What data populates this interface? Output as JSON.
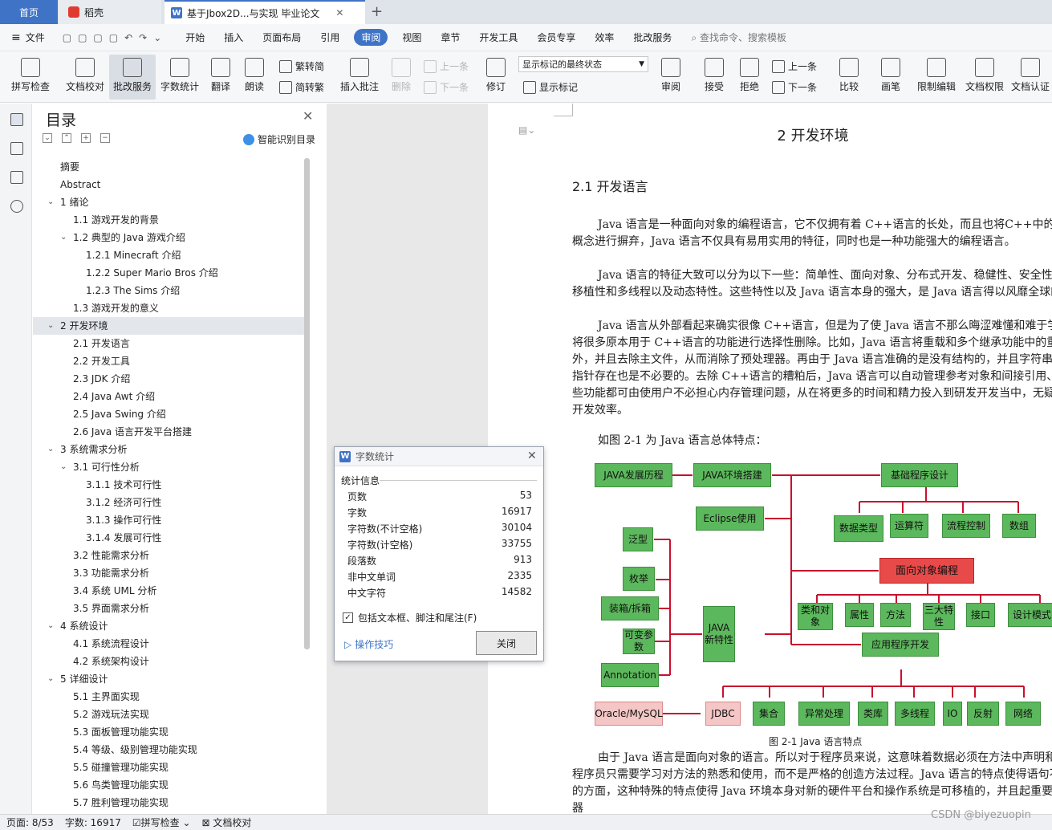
{
  "tabs": {
    "home": "首页",
    "docer": "稻壳",
    "doc": "基于Jbox2D...与实现 毕业论文",
    "add": "+"
  },
  "menu": {
    "file": "文件",
    "items": [
      "开始",
      "插入",
      "页面布局",
      "引用",
      "审阅",
      "视图",
      "章节",
      "开发工具",
      "会员专享",
      "效率",
      "批改服务"
    ],
    "active": "审阅",
    "search": "查找命令、搜索模板"
  },
  "ribbon": {
    "spell": "拼写检查",
    "proof": "文档校对",
    "correct": "批改服务",
    "count": "字数统计",
    "translate": "翻译",
    "read": "朗读",
    "fan2jian": "繁转简",
    "jian2fan": "简转繁",
    "add_comment": "插入批注",
    "delete": "删除",
    "prev": "上一条",
    "next": "下一条",
    "revise": "修订",
    "show_select": "显示标记的最终状态",
    "show_marks": "显示标记",
    "review": "审阅",
    "accept": "接受",
    "reject": "拒绝",
    "prev2": "上一条",
    "next2": "下一条",
    "compare": "比较",
    "pen": "画笔",
    "restrict": "限制编辑",
    "perm": "文档权限",
    "auth": "文档认证"
  },
  "toc": {
    "title": "目录",
    "smart": "智能识别目录",
    "items": [
      {
        "t": "摘要",
        "lv": 0
      },
      {
        "t": "Abstract",
        "lv": 0
      },
      {
        "t": "1  绪论",
        "lv": 1,
        "c": "v"
      },
      {
        "t": "1.1  游戏开发的背景",
        "lv": 2
      },
      {
        "t": "1.2  典型的 Java 游戏介绍",
        "lv": 2,
        "c": "v"
      },
      {
        "t": "1.2.1 Minecraft 介绍",
        "lv": 3
      },
      {
        "t": "1.2.2 Super Mario Bros 介绍",
        "lv": 3
      },
      {
        "t": "1.2.3 The Sims 介绍",
        "lv": 3
      },
      {
        "t": "1.3  游戏开发的意义",
        "lv": 2
      },
      {
        "t": "2  开发环境",
        "lv": 1,
        "c": "v",
        "sel": true
      },
      {
        "t": "2.1  开发语言",
        "lv": 2
      },
      {
        "t": "2.2  开发工具",
        "lv": 2
      },
      {
        "t": "2.3 JDK 介绍",
        "lv": 2
      },
      {
        "t": "2.4 Java Awt 介绍",
        "lv": 2
      },
      {
        "t": "2.5 Java Swing  介绍",
        "lv": 2
      },
      {
        "t": "2.6 Java 语言开发平台搭建",
        "lv": 2
      },
      {
        "t": "3 系统需求分析",
        "lv": 1,
        "c": "v"
      },
      {
        "t": "3.1  可行性分析",
        "lv": 2,
        "c": "v"
      },
      {
        "t": "3.1.1  技术可行性",
        "lv": 3
      },
      {
        "t": "3.1.2  经济可行性",
        "lv": 3
      },
      {
        "t": "3.1.3  操作可行性",
        "lv": 3
      },
      {
        "t": "3.1.4  发展可行性",
        "lv": 3
      },
      {
        "t": "3.2  性能需求分析",
        "lv": 2
      },
      {
        "t": "3.3  功能需求分析",
        "lv": 2
      },
      {
        "t": "3.4  系统 UML 分析",
        "lv": 2
      },
      {
        "t": "3.5 界面需求分析",
        "lv": 2
      },
      {
        "t": "4  系统设计",
        "lv": 1,
        "c": "v"
      },
      {
        "t": "4.1 系统流程设计",
        "lv": 2
      },
      {
        "t": "4.2  系统架构设计",
        "lv": 2
      },
      {
        "t": "5  详细设计",
        "lv": 1,
        "c": "v"
      },
      {
        "t": "5.1  主界面实现",
        "lv": 2
      },
      {
        "t": "5.2  游戏玩法实现",
        "lv": 2
      },
      {
        "t": "5.3  面板管理功能实现",
        "lv": 2
      },
      {
        "t": "5.4  等级、级别管理功能实现",
        "lv": 2
      },
      {
        "t": "5.5  碰撞管理功能实现",
        "lv": 2
      },
      {
        "t": "5.6  鸟类管理功能实现",
        "lv": 2
      },
      {
        "t": "5.7  胜利管理功能实现",
        "lv": 2
      }
    ]
  },
  "doc": {
    "h1": "2  开发环境",
    "h2": "2.1  开发语言",
    "p1": "Java 语言是一种面向对象的编程语言，它不仅拥有着 C++语言的长处，而且也将C++中的多重继承和指针等概念进行摒弃，Java 语言不仅具有易用实用的特征，同时也是一种功能强大的编程语言。",
    "p2": "Java 语言的特征大致可以分为以下一些：简单性、面向对象、分布式开发、稳健性、安全性、平台独立性、可移植性和多线程以及动态特性。这些特性以及 Java 语言本身的强大，是 Java 语言得以风靡全球的根本原因。",
    "p3": "Java 语言从外部看起来确实很像 C++语言，但是为了使 Java 语言不那么晦涩难懂和难于学习，开发设计人员将很多原本用于 C++语言的功能进行选择性删除。比如，Java 语言将重载和多个继承功能中的重载运算符排除在外，并且去除主文件，从而消除了预处理器。再由于 Java 语言准确的是没有结构的，并且字符串数组是对象，所以指针存在也是不必要的。去除 C++语言的糟粕后，Java 语言可以自动管理参考对象和间接引用、自动垃圾收集，这些功能都可由使用户不必担心内存管理问题，从在将更多的时间和精力投入到研发开发当中，无疑是大大提升了编程开发效率。",
    "p4": "如图 2-1 为 Java 语言总体特点：",
    "caption": "图 2-1  Java 语言特点",
    "p5": "由于 Java 语言是面向对象的语言。所以对于程序员来说，这意味着数据必须在方法中声明和操纵，笼统来说，程序员只需要学习对方法的熟悉和使用，而不是严格的创造方法过程。Java 语言的特点使得语句不单单依赖于实现的方面，这种特殊的特点使得 Java 环境本身对新的硬件平台和操作系统是可移植的，并且起重要作用的 Java 编译器"
  },
  "diagram": {
    "history": "JAVA发展历程",
    "env": "JAVA环境搭建",
    "eclipse": "Eclipse使用",
    "basic": "基础程序设计",
    "dtype": "数据类型",
    "op": "运算符",
    "flow": "流程控制",
    "arr": "数组",
    "oop": "面向对象编程",
    "cls": "类和对象",
    "attr": "属性",
    "method": "方法",
    "three": "三大特性",
    "iface": "接口",
    "pattern": "设计模式",
    "newf": "JAVA新特性",
    "generic": "泛型",
    "enum": "枚举",
    "box": "装箱/拆箱",
    "vararg": "可变参数",
    "anno": "Annotation",
    "app": "应用程序开发",
    "jdbc": "JDBC",
    "db": "Oracle/MySQL",
    "coll": "集合",
    "exc": "异常处理",
    "lib": "类库",
    "thread": "多线程",
    "io": "IO",
    "refl": "反射",
    "net": "网络"
  },
  "dialog": {
    "title": "字数统计",
    "info": "统计信息",
    "rows": [
      {
        "k": "页数",
        "v": "53"
      },
      {
        "k": "字数",
        "v": "16917"
      },
      {
        "k": "字符数(不计空格)",
        "v": "30104"
      },
      {
        "k": "字符数(计空格)",
        "v": "33755"
      },
      {
        "k": "段落数",
        "v": "913"
      },
      {
        "k": "非中文单词",
        "v": "2335"
      },
      {
        "k": "中文字符",
        "v": "14582"
      }
    ],
    "check": "包括文本框、脚注和尾注(F)",
    "tips": "操作技巧",
    "close": "关闭"
  },
  "status": {
    "page": "页面: 8/53",
    "words": "字数: 16917",
    "spell": "拼写检查",
    "proof": "文档校对"
  },
  "watermark": "CSDN @biyezuopin"
}
